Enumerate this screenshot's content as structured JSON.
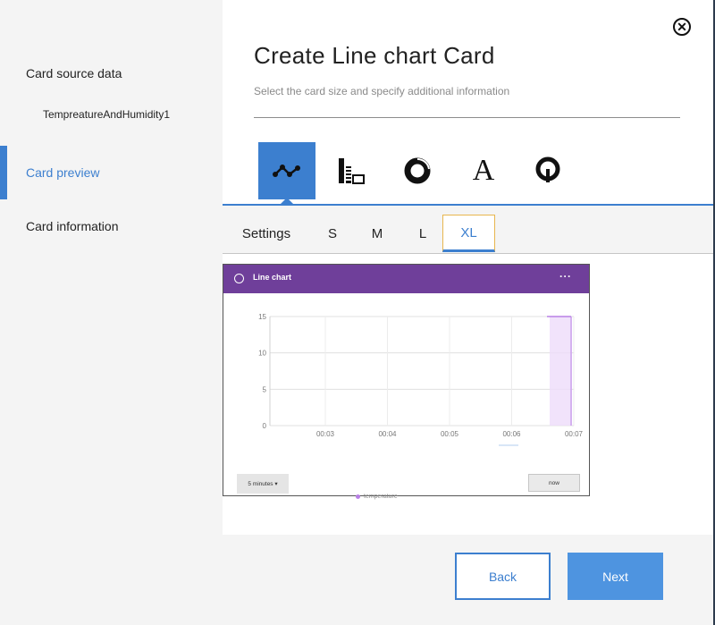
{
  "sidebar": {
    "items": [
      {
        "label": "Card source data",
        "sub": "TempreatureAndHumidity1"
      },
      {
        "label": "Card preview"
      },
      {
        "label": "Card information"
      }
    ],
    "accent_color": "#3c7fcf"
  },
  "modal": {
    "title": "Create Line chart Card",
    "subtitle": "Select the card size and specify additional information",
    "close_icon": "close-circle-icon"
  },
  "chart_types": [
    {
      "icon": "line-chart-icon",
      "selected": true
    },
    {
      "icon": "bar-table-icon",
      "selected": false
    },
    {
      "icon": "donut-icon",
      "selected": false
    },
    {
      "icon": "text-icon",
      "glyph": "A",
      "selected": false
    },
    {
      "icon": "gauge-icon",
      "selected": false
    }
  ],
  "tabs": [
    {
      "label": "Settings"
    },
    {
      "label": "S"
    },
    {
      "label": "M"
    },
    {
      "label": "L"
    },
    {
      "label": "XL",
      "active": true
    }
  ],
  "card": {
    "header_title": "Line chart",
    "header_color": "#6f3f9a",
    "menu_label": "···",
    "range_select": "5 minutes ▾",
    "now_button": "now",
    "legend_label": "temperature",
    "series_color": "#b980e6"
  },
  "chart_data": {
    "type": "line",
    "x_ticks": [
      "00:03",
      "00:04",
      "00:05",
      "00:06",
      "00:07"
    ],
    "y_ticks": [
      0,
      5,
      10,
      15
    ],
    "ylim": [
      0,
      15
    ],
    "series": [
      {
        "name": "temperature",
        "points": [
          {
            "x": "00:07",
            "y": 15
          }
        ]
      }
    ],
    "grid": true,
    "legend_position": "bottom"
  },
  "footer": {
    "back_label": "Back",
    "next_label": "Next"
  }
}
